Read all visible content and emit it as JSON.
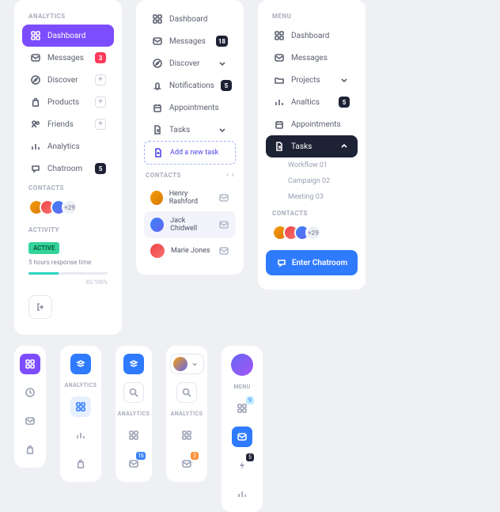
{
  "panel1": {
    "section": "ANALYTICS",
    "items": [
      {
        "label": "Dashboard"
      },
      {
        "label": "Messages",
        "badge": "3"
      },
      {
        "label": "Discover"
      },
      {
        "label": "Products"
      },
      {
        "label": "Friends"
      },
      {
        "label": "Analytics"
      },
      {
        "label": "Chatroom",
        "badge": "5"
      }
    ],
    "contacts_label": "CONTACTS",
    "avatars_more": "+29",
    "activity_label": "ACTIVITY",
    "activity_chip": "ACTIVE",
    "activity_text": "5 hours response time",
    "activity_ratio": "85/100%"
  },
  "panel2": {
    "items": [
      {
        "label": "Dashboard"
      },
      {
        "label": "Messages",
        "badge": "18"
      },
      {
        "label": "Discover"
      },
      {
        "label": "Notifications",
        "badge": "5"
      },
      {
        "label": "Appointments"
      },
      {
        "label": "Tasks"
      }
    ],
    "add_task": "Add a new task",
    "contacts_label": "CONTACTS",
    "contacts": [
      {
        "name": "Henry Rashford"
      },
      {
        "name": "Jack Chidwell"
      },
      {
        "name": "Marie Jones"
      }
    ]
  },
  "panel3": {
    "section": "MENU",
    "items": [
      {
        "label": "Dashboard"
      },
      {
        "label": "Messages"
      },
      {
        "label": "Projects"
      },
      {
        "label": "Analtics",
        "badge": "5"
      },
      {
        "label": "Appointments"
      },
      {
        "label": "Tasks"
      }
    ],
    "subtasks": [
      "Workflow 01",
      "Campaign 02",
      "Meeting 03"
    ],
    "contacts_label": "CONTACTS",
    "avatars_more": "+29",
    "enter": "Enter Chatroom"
  },
  "mini": {
    "analytics_label": "ANALYTICS",
    "menu_label": "MENU",
    "badge16": "16",
    "badge3": "3",
    "badge5": "5",
    "badge9": "9"
  }
}
